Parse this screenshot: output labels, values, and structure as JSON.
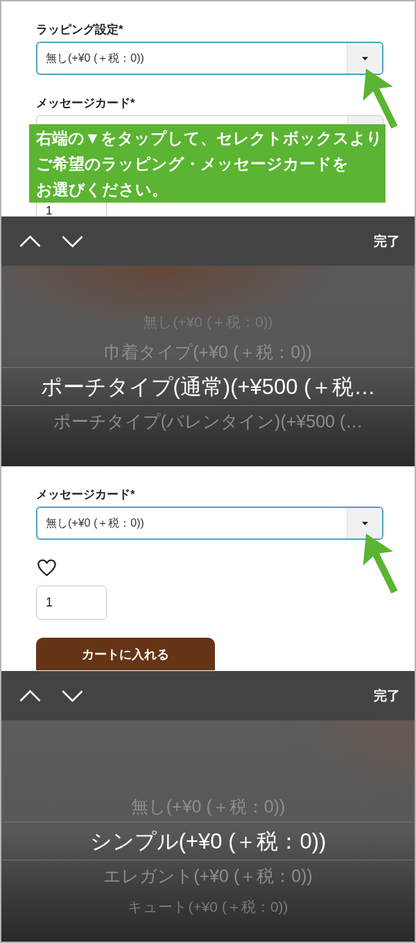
{
  "screens": [
    {
      "kind": "form",
      "items": [
        {
          "kind": "select",
          "label": "ラッピング設定*",
          "value": "無し(+¥0 (＋税：0))",
          "focused": true
        },
        {
          "kind": "arrow"
        },
        {
          "kind": "select",
          "label": "メッセージカード*",
          "focused": false
        },
        {
          "kind": "callout",
          "lines": [
            "右端の▼をタップして、セレクトボックスより",
            "ご希望のラッピング・メッセージカードを",
            "お選びください。"
          ]
        },
        {
          "kind": "quantity",
          "value": "1"
        }
      ]
    },
    {
      "kind": "picker",
      "done": "完了",
      "options": [
        {
          "label": "無し(+¥0 (＋税：0))",
          "selected": false
        },
        {
          "label": "巾着タイプ(+¥0 (＋税：0))",
          "selected": false
        },
        {
          "label": "ポーチタイプ(通常)(+¥500 (＋税…",
          "selected": true
        },
        {
          "label": "ポーチタイプ(バレンタイン)(+¥500 (…",
          "selected": false
        }
      ]
    },
    {
      "kind": "form",
      "items": [
        {
          "kind": "select",
          "label": "メッセージカード*",
          "value": "無し(+¥0 (＋税：0))",
          "focused": true
        },
        {
          "kind": "arrow"
        },
        {
          "kind": "favorite"
        },
        {
          "kind": "quantity",
          "value": "1"
        },
        {
          "kind": "button",
          "label": "カートに入れる"
        }
      ]
    },
    {
      "kind": "picker",
      "done": "完了",
      "options": [
        {
          "label": "無し(+¥0 (＋税：0))",
          "selected": false
        },
        {
          "label": "シンプル(+¥0 (＋税：0))",
          "selected": true
        },
        {
          "label": "エレガント(+¥0 (＋税：0))",
          "selected": false
        },
        {
          "label": "キュート(+¥0 (＋税：0))",
          "selected": false
        }
      ]
    }
  ]
}
